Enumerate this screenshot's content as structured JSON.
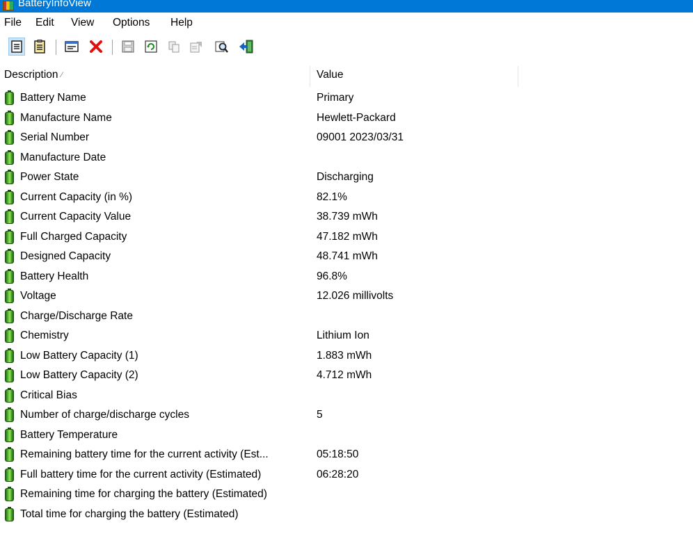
{
  "window": {
    "title": "BatteryInfoView"
  },
  "menu": [
    "File",
    "Edit",
    "View",
    "Options",
    "Help"
  ],
  "toolbar": {
    "icons": [
      "list-view-icon",
      "detail-view-icon",
      "battery-log-icon",
      "delete-icon",
      "save-icon",
      "refresh-icon",
      "copy-icon",
      "properties-icon",
      "find-icon",
      "exit-icon"
    ]
  },
  "columns": {
    "description": "Description",
    "value": "Value"
  },
  "rows": [
    {
      "label": "Battery Name",
      "value": "Primary"
    },
    {
      "label": "Manufacture Name",
      "value": "Hewlett-Packard"
    },
    {
      "label": "Serial Number",
      "value": "09001 2023/03/31"
    },
    {
      "label": "Manufacture Date",
      "value": ""
    },
    {
      "label": "Power State",
      "value": "Discharging"
    },
    {
      "label": "Current Capacity (in %)",
      "value": "82.1%"
    },
    {
      "label": "Current Capacity Value",
      "value": "38.739 mWh"
    },
    {
      "label": "Full Charged Capacity",
      "value": "47.182 mWh"
    },
    {
      "label": "Designed Capacity",
      "value": "48.741 mWh"
    },
    {
      "label": "Battery Health",
      "value": "96.8%"
    },
    {
      "label": "Voltage",
      "value": "12.026 millivolts"
    },
    {
      "label": "Charge/Discharge Rate",
      "value": ""
    },
    {
      "label": "Chemistry",
      "value": "Lithium Ion"
    },
    {
      "label": "Low Battery Capacity (1)",
      "value": "1.883 mWh"
    },
    {
      "label": "Low Battery Capacity (2)",
      "value": "4.712 mWh"
    },
    {
      "label": "Critical Bias",
      "value": ""
    },
    {
      "label": "Number of charge/discharge cycles",
      "value": "5"
    },
    {
      "label": "Battery Temperature",
      "value": ""
    },
    {
      "label": "Remaining battery time for the current activity (Est...",
      "value": "05:18:50"
    },
    {
      "label": "Full battery time for the current activity (Estimated)",
      "value": "06:28:20"
    },
    {
      "label": "Remaining time for charging the battery (Estimated)",
      "value": ""
    },
    {
      "label": "Total  time for charging the battery (Estimated)",
      "value": ""
    }
  ]
}
